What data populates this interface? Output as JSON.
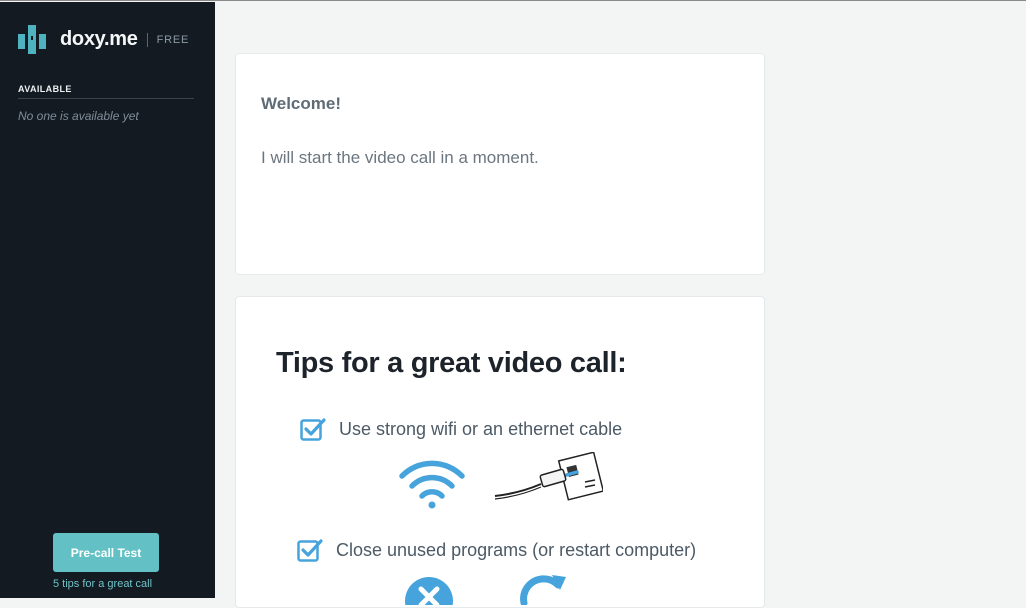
{
  "sidebar": {
    "brand_name": "doxy.me",
    "plan": "FREE",
    "available_title": "AVAILABLE",
    "available_empty": "No one is available yet",
    "precall_button": "Pre-call Test",
    "tips_link": "5 tips for a great call"
  },
  "welcome": {
    "title": "Welcome!",
    "message": "I will start the video call in a moment."
  },
  "tips": {
    "title": "Tips for a great video call:",
    "items": [
      {
        "text": "Use strong wifi or an ethernet cable",
        "checked": true,
        "icons": [
          "wifi-icon",
          "ethernet-cable-icon"
        ]
      },
      {
        "text": "Close unused programs (or restart computer)",
        "checked": true,
        "icons": [
          "close-icon",
          "restart-icon"
        ]
      }
    ]
  },
  "colors": {
    "sidebar_bg": "#131a22",
    "accent": "#63c1c6",
    "logo": "#4fb3bf",
    "illustration_blue": "#46a3dc",
    "page_bg": "#f3f5f5"
  }
}
